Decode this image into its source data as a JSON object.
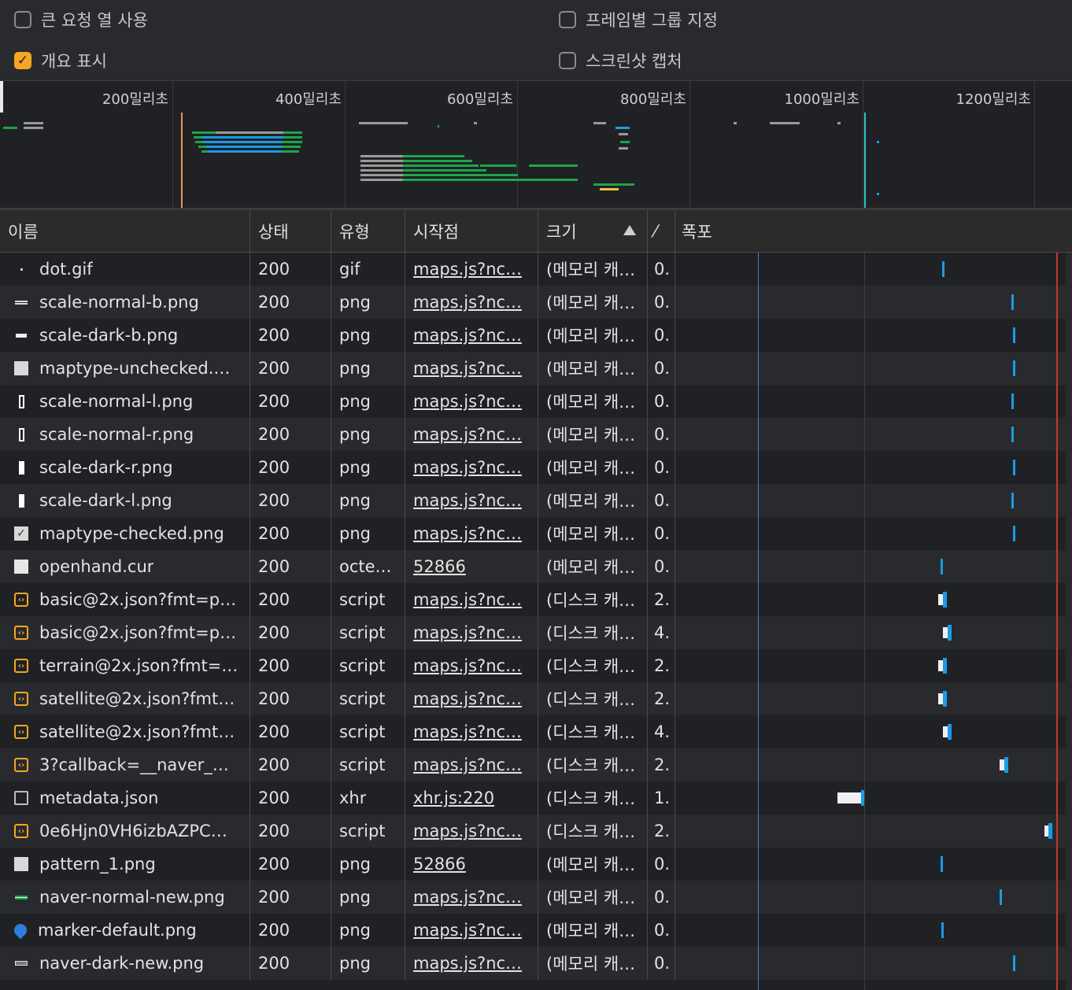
{
  "settings": {
    "large_rows": {
      "label": "큰 요청 열 사용",
      "checked": false
    },
    "group_by_frame": {
      "label": "프레임별 그룹 지정",
      "checked": false
    },
    "show_overview": {
      "label": "개요 표시",
      "checked": true
    },
    "screenshots": {
      "label": "스크린샷 캡처",
      "checked": false
    }
  },
  "overview": {
    "ticks": [
      "200밀리초",
      "400밀리초",
      "600밀리초",
      "800밀리초",
      "1000밀리초",
      "1200밀리초"
    ]
  },
  "table": {
    "columns": {
      "name": "이름",
      "status": "상태",
      "type": "유형",
      "initiator": "시작점",
      "size": "크기",
      "time": "⁄",
      "waterfall": "폭포"
    },
    "rows": [
      {
        "name": "dot.gif",
        "status": "200",
        "type": "gif",
        "initiator": "maps.js?nc…",
        "size": "(메모리 캐…",
        "time": "0.",
        "icon": "image-dot-icon"
      },
      {
        "name": "scale-normal-b.png",
        "status": "200",
        "type": "png",
        "initiator": "maps.js?nc…",
        "size": "(메모리 캐…",
        "time": "0.",
        "icon": "image-line-icon"
      },
      {
        "name": "scale-dark-b.png",
        "status": "200",
        "type": "png",
        "initiator": "maps.js?nc…",
        "size": "(메모리 캐…",
        "time": "0.",
        "icon": "image-bar-icon"
      },
      {
        "name": "maptype-unchecked.…",
        "status": "200",
        "type": "png",
        "initiator": "maps.js?nc…",
        "size": "(메모리 캐…",
        "time": "0.",
        "icon": "image-square-icon"
      },
      {
        "name": "scale-normal-l.png",
        "status": "200",
        "type": "png",
        "initiator": "maps.js?nc…",
        "size": "(메모리 캐…",
        "time": "0.",
        "icon": "image-tall-bordered-icon"
      },
      {
        "name": "scale-normal-r.png",
        "status": "200",
        "type": "png",
        "initiator": "maps.js?nc…",
        "size": "(메모리 캐…",
        "time": "0.",
        "icon": "image-tall-bordered-icon"
      },
      {
        "name": "scale-dark-r.png",
        "status": "200",
        "type": "png",
        "initiator": "maps.js?nc…",
        "size": "(메모리 캐…",
        "time": "0.",
        "icon": "image-tall-icon"
      },
      {
        "name": "scale-dark-l.png",
        "status": "200",
        "type": "png",
        "initiator": "maps.js?nc…",
        "size": "(메모리 캐…",
        "time": "0.",
        "icon": "image-tall-icon"
      },
      {
        "name": "maptype-checked.png",
        "status": "200",
        "type": "png",
        "initiator": "maps.js?nc…",
        "size": "(메모리 캐…",
        "time": "0.",
        "icon": "image-check-icon"
      },
      {
        "name": "openhand.cur",
        "status": "200",
        "type": "octe…",
        "initiator": "52866",
        "size": "(메모리 캐…",
        "time": "0.",
        "icon": "cursor-file-icon"
      },
      {
        "name": "basic@2x.json?fmt=p…",
        "status": "200",
        "type": "script",
        "initiator": "maps.js?nc…",
        "size": "(디스크 캐…",
        "time": "2.",
        "icon": "script-icon"
      },
      {
        "name": "basic@2x.json?fmt=p…",
        "status": "200",
        "type": "script",
        "initiator": "maps.js?nc…",
        "size": "(디스크 캐…",
        "time": "4.",
        "icon": "script-icon"
      },
      {
        "name": "terrain@2x.json?fmt=…",
        "status": "200",
        "type": "script",
        "initiator": "maps.js?nc…",
        "size": "(디스크 캐…",
        "time": "2.",
        "icon": "script-icon"
      },
      {
        "name": "satellite@2x.json?fmt…",
        "status": "200",
        "type": "script",
        "initiator": "maps.js?nc…",
        "size": "(디스크 캐…",
        "time": "2.",
        "icon": "script-icon"
      },
      {
        "name": "satellite@2x.json?fmt…",
        "status": "200",
        "type": "script",
        "initiator": "maps.js?nc…",
        "size": "(디스크 캐…",
        "time": "4.",
        "icon": "script-icon"
      },
      {
        "name": "3?callback=__naver_…",
        "status": "200",
        "type": "script",
        "initiator": "maps.js?nc…",
        "size": "(디스크 캐…",
        "time": "2.",
        "icon": "script-icon"
      },
      {
        "name": "metadata.json",
        "status": "200",
        "type": "xhr",
        "initiator": "xhr.js:220",
        "size": "(디스크 캐…",
        "time": "1.",
        "icon": "document-icon"
      },
      {
        "name": "0e6Hjn0VH6izbAZPC…",
        "status": "200",
        "type": "script",
        "initiator": "maps.js?nc…",
        "size": "(디스크 캐…",
        "time": "2.",
        "icon": "script-icon"
      },
      {
        "name": "pattern_1.png",
        "status": "200",
        "type": "png",
        "initiator": "52866",
        "size": "(메모리 캐…",
        "time": "0.",
        "icon": "image-square-icon"
      },
      {
        "name": "naver-normal-new.png",
        "status": "200",
        "type": "png",
        "initiator": "maps.js?nc…",
        "size": "(메모리 캐…",
        "time": "0.",
        "icon": "image-green-icon"
      },
      {
        "name": "marker-default.png",
        "status": "200",
        "type": "png",
        "initiator": "maps.js?nc…",
        "size": "(메모리 캐…",
        "time": "0.",
        "icon": "marker-icon"
      },
      {
        "name": "naver-dark-new.png",
        "status": "200",
        "type": "png",
        "initiator": "maps.js?nc…",
        "size": "(메모리 캐…",
        "time": "0.",
        "icon": "image-dark-icon"
      }
    ]
  }
}
